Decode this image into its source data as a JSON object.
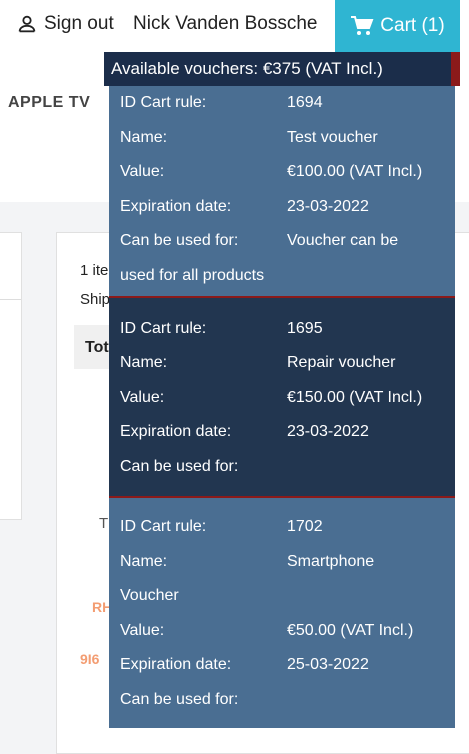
{
  "header": {
    "sign_out": "Sign out",
    "user_name": "Nick Vanden Bossche",
    "cart_label": "Cart (1)"
  },
  "nav": {
    "category": "APPLE TV"
  },
  "background": {
    "item_count_fragment": "1 ite",
    "shipping_fragment": "Ship",
    "total_fragment": "Tot",
    "t_fragment": "T",
    "rh_fragment": "RH",
    "code_fragment": "9I6"
  },
  "vouchers": {
    "title": "Available vouchers: €375 (VAT Incl.)",
    "labels": {
      "id": "ID Cart rule:",
      "name": "Name:",
      "value": "Value:",
      "expiration": "Expiration date:",
      "usage": "Can be used for:"
    },
    "items": [
      {
        "id": "1694",
        "name": "Test voucher",
        "value": "€100.00 (VAT Incl.)",
        "expiration": "23-03-2022",
        "usage": "Voucher can be",
        "usage_cont": "used for all products"
      },
      {
        "id": "1695",
        "name": "Repair voucher",
        "value": "€150.00 (VAT Incl.)",
        "expiration": "23-03-2022",
        "usage": ""
      },
      {
        "id": "1702",
        "name": "Smartphone",
        "name_cont": "Voucher",
        "value": "€50.00 (VAT Incl.)",
        "expiration": "25-03-2022",
        "usage": ""
      }
    ]
  },
  "colors": {
    "accent": "#2fb5d2",
    "voucher_header": "#1b2d4a",
    "voucher_light": "#4a6e92",
    "voucher_dark": "#223650",
    "separator": "#8b1a1a"
  }
}
